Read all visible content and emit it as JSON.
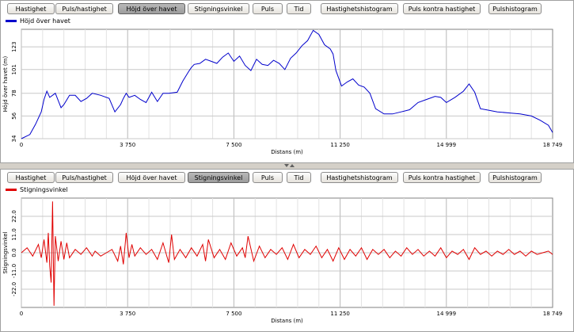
{
  "tabs": [
    "Hastighet",
    "Puls/hastighet",
    "Höjd över havet",
    "Stigningsvinkel",
    "Puls",
    "Tid",
    "Hastighetshistogram",
    "Puls kontra hastighet",
    "Pulshistogram"
  ],
  "panels": [
    {
      "active_tab": "Höjd över havet",
      "legend_label": "Höjd över havet",
      "color": "#0000cc",
      "chart_data": {
        "type": "line",
        "series": [
          {
            "name": "Höjd över havet",
            "color": "#0000cc"
          }
        ],
        "ylabel": "Höjd över havet (m)",
        "xlabel": "Distans (m)",
        "ylim": [
          34,
          140
        ],
        "xlim": [
          0,
          18749
        ],
        "y_ticks": [
          34,
          56,
          78,
          101,
          123
        ],
        "x_ticks": [
          0,
          3750,
          7500,
          11250,
          14999,
          18749
        ],
        "x_tick_labels": [
          "0",
          "3 750",
          "7 500",
          "11 250",
          "14 999",
          "18 749"
        ],
        "x": [
          0,
          300,
          500,
          700,
          800,
          900,
          1000,
          1200,
          1400,
          1500,
          1700,
          1900,
          2100,
          2300,
          2500,
          2800,
          3100,
          3300,
          3500,
          3600,
          3700,
          3800,
          4000,
          4200,
          4400,
          4600,
          4800,
          5000,
          5200,
          5500,
          5700,
          5900,
          6000,
          6100,
          6300,
          6500,
          6700,
          6900,
          7100,
          7300,
          7500,
          7700,
          7900,
          8100,
          8300,
          8500,
          8700,
          8900,
          9100,
          9300,
          9500,
          9700,
          9900,
          10100,
          10300,
          10500,
          10700,
          10900,
          11000,
          11100,
          11300,
          11500,
          11700,
          11900,
          12100,
          12300,
          12500,
          12800,
          13100,
          13400,
          13700,
          14000,
          14300,
          14600,
          14800,
          15000,
          15300,
          15600,
          15800,
          16000,
          16200,
          16400,
          16800,
          17200,
          17600,
          18000,
          18300,
          18600,
          18749
        ],
        "values": [
          34,
          38,
          48,
          60,
          72,
          80,
          74,
          78,
          64,
          67,
          76,
          76,
          70,
          73,
          78,
          76,
          73,
          60,
          67,
          73,
          78,
          74,
          76,
          72,
          69,
          79,
          70,
          78,
          78,
          79,
          90,
          99,
          103,
          106,
          107,
          111,
          109,
          107,
          113,
          117,
          109,
          114,
          105,
          100,
          111,
          106,
          105,
          110,
          107,
          101,
          112,
          117,
          124,
          129,
          139,
          135,
          125,
          121,
          116,
          100,
          85,
          89,
          92,
          86,
          84,
          78,
          63,
          58,
          58,
          60,
          62,
          69,
          72,
          75,
          74,
          69,
          74,
          80,
          87,
          79,
          63,
          62,
          60,
          59,
          58,
          56,
          52,
          47,
          40
        ]
      }
    },
    {
      "active_tab": "Stigningsvinkel",
      "legend_label": "Stigningsvinkel",
      "color": "#e00000",
      "chart_data": {
        "type": "line",
        "series": [
          {
            "name": "Stigningsvinkel",
            "color": "#e00000"
          }
        ],
        "ylabel": "Stigningsvinkel",
        "xlabel": "Distans (m)",
        "ylim": [
          -33,
          33
        ],
        "xlim": [
          0,
          18749
        ],
        "y_ticks": [
          -22,
          -11,
          0,
          11,
          22
        ],
        "y_tick_labels": [
          "-22.0",
          "-11.0",
          "0.0",
          "11.0",
          "22.0"
        ],
        "x_ticks": [
          0,
          3750,
          7500,
          11250,
          14999,
          18749
        ],
        "x_tick_labels": [
          "0",
          "3 750",
          "7 500",
          "11 250",
          "14 999",
          "18 749"
        ],
        "x": [
          0,
          200,
          400,
          600,
          700,
          800,
          900,
          950,
          1000,
          1050,
          1100,
          1150,
          1200,
          1300,
          1400,
          1500,
          1600,
          1700,
          1900,
          2100,
          2300,
          2500,
          2600,
          2800,
          3000,
          3200,
          3400,
          3500,
          3600,
          3700,
          3800,
          3900,
          4000,
          4200,
          4400,
          4600,
          4800,
          5000,
          5200,
          5300,
          5400,
          5600,
          5800,
          6000,
          6200,
          6400,
          6500,
          6600,
          6800,
          7000,
          7200,
          7400,
          7600,
          7800,
          7900,
          8000,
          8200,
          8400,
          8600,
          8800,
          9000,
          9200,
          9400,
          9600,
          9800,
          10000,
          10200,
          10400,
          10600,
          10800,
          11000,
          11200,
          11400,
          11600,
          11800,
          12000,
          12200,
          12400,
          12600,
          12800,
          13000,
          13200,
          13400,
          13600,
          13800,
          14000,
          14200,
          14400,
          14600,
          14800,
          15000,
          15200,
          15400,
          15600,
          15800,
          16000,
          16200,
          16400,
          16600,
          16800,
          17000,
          17200,
          17400,
          17600,
          17800,
          18000,
          18200,
          18400,
          18600,
          18749
        ],
        "values": [
          0,
          3,
          -2,
          5,
          -3,
          8,
          -6,
          12,
          -8,
          -18,
          31,
          -32,
          10,
          -5,
          7,
          -4,
          6,
          -3,
          2,
          -1,
          3,
          -2,
          1,
          -2,
          0,
          2,
          -5,
          4,
          -7,
          12,
          -3,
          5,
          -2,
          3,
          -1,
          2,
          -4,
          6,
          -6,
          11,
          -4,
          2,
          -3,
          3,
          -2,
          5,
          -5,
          8,
          -3,
          2,
          -4,
          6,
          -2,
          3,
          -3,
          10,
          -5,
          4,
          -3,
          2,
          -1,
          3,
          -4,
          5,
          -3,
          2,
          -1,
          4,
          -3,
          2,
          -5,
          3,
          -4,
          2,
          -2,
          3,
          -4,
          2,
          -1,
          2,
          -3,
          1,
          -2,
          3,
          -1,
          2,
          -2,
          1,
          -2,
          3,
          -3,
          1,
          -1,
          2,
          -4,
          3,
          -1,
          1,
          -2,
          1,
          -1,
          2,
          -1,
          1,
          -2,
          1,
          -1,
          0,
          1,
          -1,
          0,
          -2
        ]
      }
    }
  ]
}
